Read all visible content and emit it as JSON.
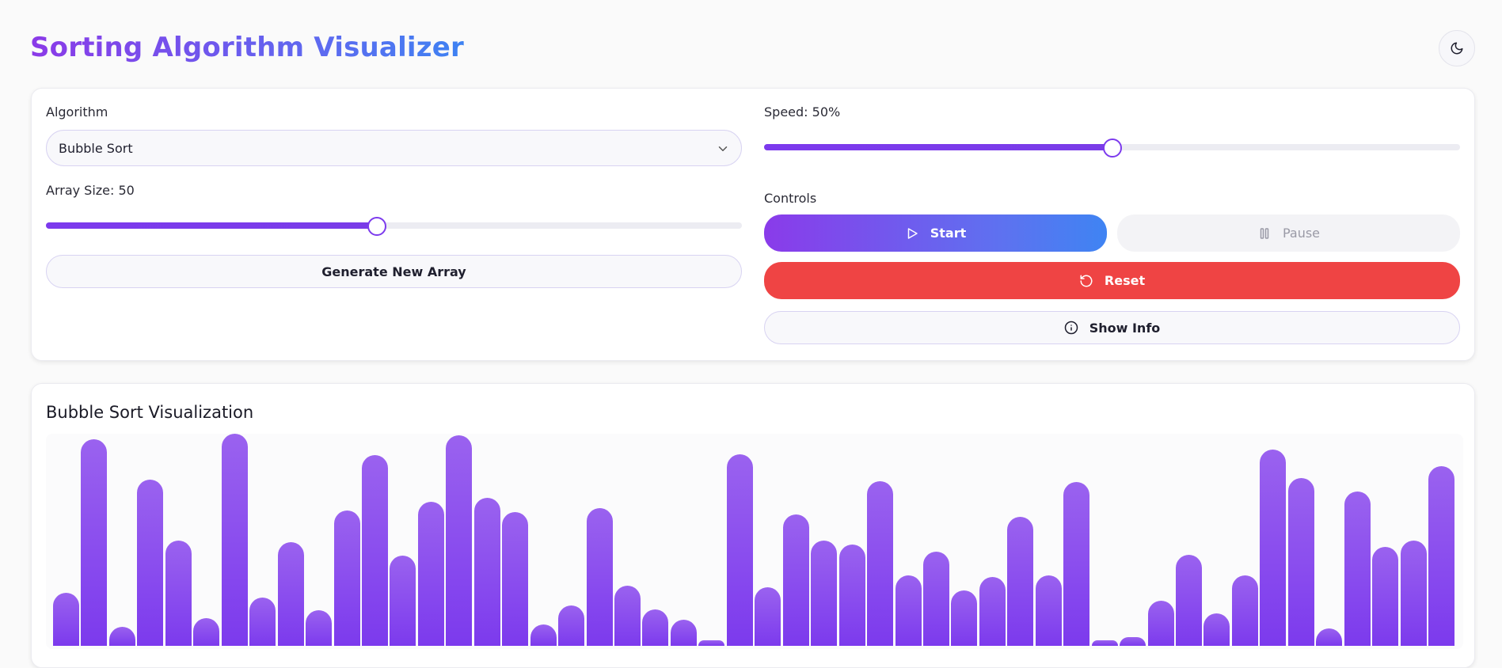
{
  "header": {
    "title": "Sorting Algorithm Visualizer",
    "theme_toggle_icon": "moon-icon"
  },
  "controls": {
    "algorithm_label": "Algorithm",
    "algorithm_selected": "Bubble Sort",
    "array_size_label": "Array Size: 50",
    "array_size_value": 50,
    "array_size_fraction": 0.475,
    "generate_button": "Generate New Array",
    "speed_label": "Speed: 50%",
    "speed_fraction": 0.5,
    "controls_label": "Controls",
    "start_button": "Start",
    "pause_button": "Pause",
    "reset_button": "Reset",
    "info_button": "Show Info"
  },
  "visualization": {
    "title": "Bubble Sort Visualization",
    "bar_color": "#7c3aed",
    "values": [
      67,
      261,
      24,
      210,
      133,
      35,
      268,
      61,
      131,
      45,
      171,
      241,
      114,
      182,
      266,
      187,
      169,
      27,
      51,
      174,
      76,
      46,
      33,
      7,
      242,
      74,
      166,
      133,
      128,
      208,
      89,
      119,
      70,
      87,
      163,
      89,
      207,
      7,
      11,
      57,
      115,
      41,
      89,
      248,
      212,
      22,
      195,
      125,
      133,
      227
    ]
  },
  "colors": {
    "accent_purple": "#7c3aed",
    "accent_blue": "#3f84f3",
    "reset_red": "#ef4444"
  }
}
